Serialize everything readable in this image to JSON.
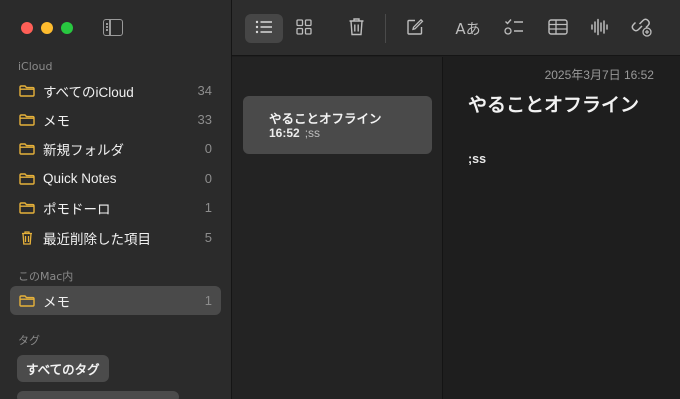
{
  "sidebar": {
    "sections": {
      "icloud": "iCloud",
      "mac": "このMac内",
      "tags": "タグ"
    },
    "icloud_folders": [
      {
        "label": "すべてのiCloud",
        "count": "34",
        "icon": "folder-icon"
      },
      {
        "label": "メモ",
        "count": "33",
        "icon": "folder-icon"
      },
      {
        "label": "新規フォルダ",
        "count": "0",
        "icon": "folder-icon"
      },
      {
        "label": "Quick Notes",
        "count": "0",
        "icon": "folder-icon"
      },
      {
        "label": "ポモドーロ",
        "count": "1",
        "icon": "folder-icon"
      },
      {
        "label": "最近削除した項目",
        "count": "5",
        "icon": "trash-icon"
      }
    ],
    "mac_folders": [
      {
        "label": "メモ",
        "count": "1",
        "icon": "folder-icon",
        "selected": true
      }
    ],
    "tag_chip": "すべてのタグ"
  },
  "toolbar": {
    "buttons": [
      "list-view-icon",
      "gallery-view-icon",
      "delete-icon",
      "compose-icon",
      "format-icon",
      "checklist-icon",
      "table-icon",
      "audio-icon",
      "share-collaborate-icon"
    ],
    "format_label": "Aあ"
  },
  "note_list": {
    "notes": [
      {
        "title": "やることオフライン",
        "time": "16:52",
        "preview": ";ss"
      }
    ]
  },
  "editor": {
    "date": "2025年3月7日 16:52",
    "title": "やることオフライン",
    "body": ";ss"
  },
  "colors": {
    "accent_folder": "#e6b13a",
    "traffic_red": "#ff5f57",
    "traffic_yellow": "#febc2e",
    "traffic_green": "#28c840"
  }
}
